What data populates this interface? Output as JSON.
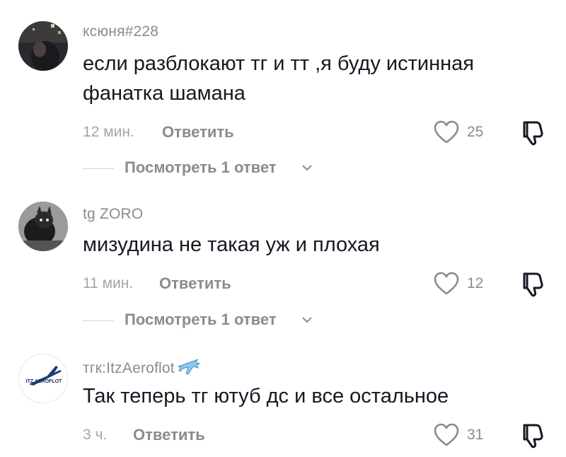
{
  "comments": [
    {
      "username": "ксюня#228",
      "text": "если разблокают тг и тт ,я буду истинная фанатка шамана",
      "time": "12 мин.",
      "reply_label": "Ответить",
      "likes": "25",
      "view_replies": "Посмотреть 1 ответ"
    },
    {
      "username": "tg ZORO",
      "text": "мизудина не такая уж и плохая",
      "time": "11 мин.",
      "reply_label": "Ответить",
      "likes": "12",
      "view_replies": "Посмотреть 1 ответ"
    },
    {
      "username": "тгк:ItzAeroflot",
      "username_emoji": "✈️",
      "text": "Так теперь тг ютуб дс и все остальное",
      "time": "3 ч.",
      "reply_label": "Ответить",
      "likes": "31",
      "avatar_logo_text": "ITZ AEROFLOT"
    }
  ],
  "icons": {
    "like": "heart-outline-icon",
    "dislike": "thumbs-down-icon",
    "chevron": "chevron-down-icon"
  }
}
